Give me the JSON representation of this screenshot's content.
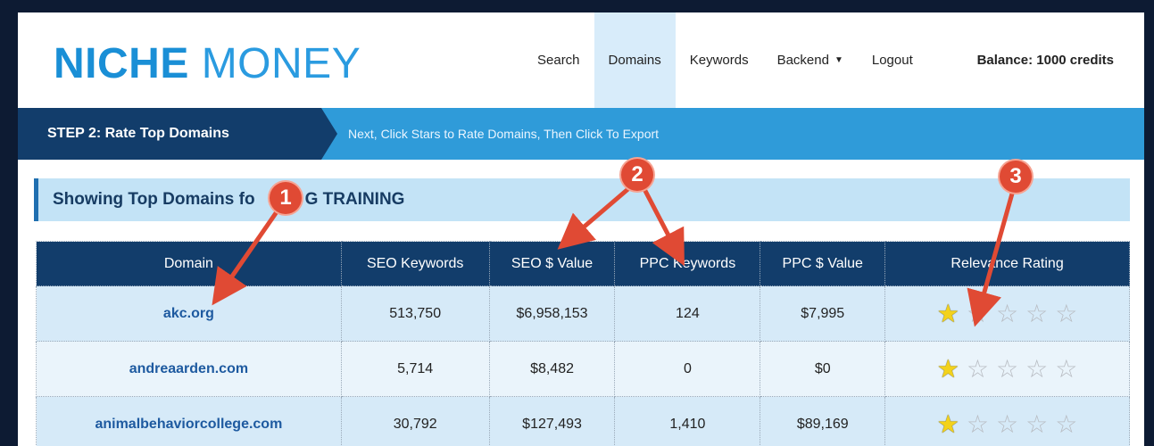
{
  "logo": {
    "part1": "NICHE",
    "part2": "MONEY"
  },
  "nav": {
    "items": [
      {
        "label": "Search"
      },
      {
        "label": "Domains"
      },
      {
        "label": "Keywords"
      },
      {
        "label": "Backend"
      },
      {
        "label": "Logout"
      }
    ],
    "balance": "Balance: 1000 credits"
  },
  "step": {
    "label": "STEP 2: Rate Top Domains",
    "instruction": "Next, Click Stars to Rate Domains, Then Click To Export"
  },
  "showing": {
    "title_left": "Showing Top Domains fo",
    "title_right": "G TRAINING"
  },
  "table": {
    "headers": [
      "Domain",
      "SEO Keywords",
      "SEO $ Value",
      "PPC Keywords",
      "PPC $ Value",
      "Relevance Rating"
    ],
    "rows": [
      {
        "domain": "akc.org",
        "seo_keywords": "513,750",
        "seo_value": "$6,958,153",
        "ppc_keywords": "124",
        "ppc_value": "$7,995",
        "rating": 1
      },
      {
        "domain": "andreaarden.com",
        "seo_keywords": "5,714",
        "seo_value": "$8,482",
        "ppc_keywords": "0",
        "ppc_value": "$0",
        "rating": 1
      },
      {
        "domain": "animalbehaviorcollege.com",
        "seo_keywords": "30,792",
        "seo_value": "$127,493",
        "ppc_keywords": "1,410",
        "ppc_value": "$89,169",
        "rating": 1
      }
    ]
  },
  "annotations": {
    "markers": [
      "1",
      "2",
      "3"
    ],
    "color": "#e04a34"
  },
  "colors": {
    "brand": "#1a8fd6",
    "navy": "#123d6b",
    "stepbar": "#2f9bd9",
    "star": "#f3d21b"
  }
}
